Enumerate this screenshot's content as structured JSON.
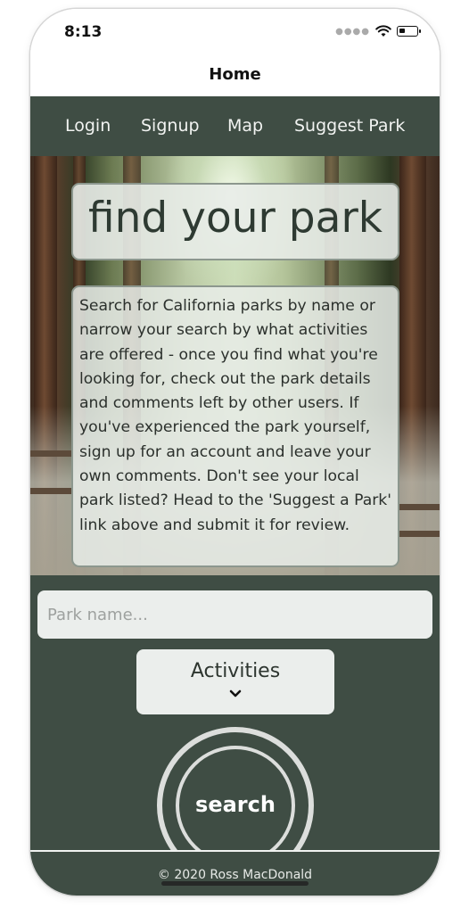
{
  "status_bar": {
    "time": "8:13",
    "signal_icon": "signal-dots-icon",
    "wifi_icon": "wifi-icon",
    "battery_icon": "battery-icon",
    "battery_level": 0.35
  },
  "nav_bar": {
    "title": "Home"
  },
  "app_nav": {
    "links": [
      {
        "label": "Login"
      },
      {
        "label": "Signup"
      },
      {
        "label": "Map"
      },
      {
        "label": "Suggest Park"
      }
    ]
  },
  "hero": {
    "title": "find your park",
    "description": "Search for California parks by name or narrow your search by what activities are offered - once you find what you're looking for, check out the park details and comments left by other users. If you've experienced the park yourself, sign up for an account and leave your own comments. Don't see your local park listed? Head to the 'Suggest a Park' link above and submit it for review."
  },
  "search": {
    "park_name_placeholder": "Park name...",
    "park_name_value": "",
    "activities_label": "Activities",
    "activities_icon": "chevron-down-icon",
    "search_label": "search"
  },
  "footer": {
    "text": "© 2020 Ross MacDonald"
  },
  "colors": {
    "primary_green": "#3f4d44",
    "panel_gray": "#ebeeec",
    "text_light": "#f1f3f1"
  }
}
